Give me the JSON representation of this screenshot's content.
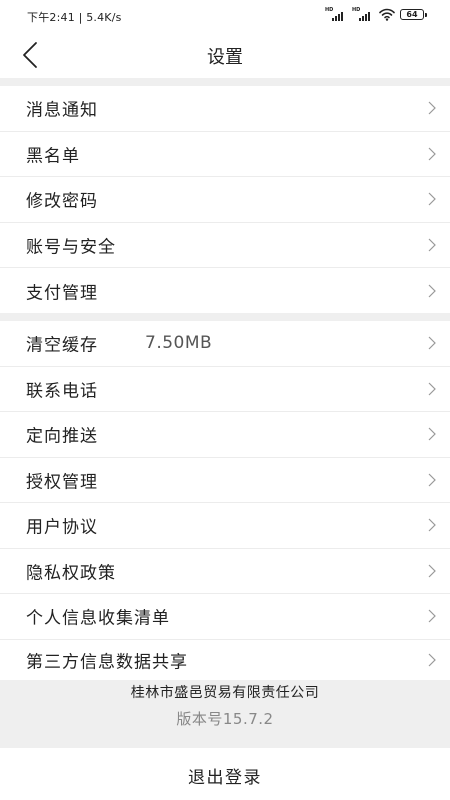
{
  "status_bar": {
    "time_speed": "下午2:41 | 5.4K/s",
    "signal_label": "HD",
    "battery": "64"
  },
  "nav": {
    "title": "设置"
  },
  "group1": [
    {
      "label": "消息通知"
    },
    {
      "label": "黑名单"
    },
    {
      "label": "修改密码"
    },
    {
      "label": "账号与安全"
    },
    {
      "label": "支付管理"
    }
  ],
  "group2": [
    {
      "label": "清空缓存",
      "value": "7.50MB"
    },
    {
      "label": "联系电话"
    },
    {
      "label": "定向推送"
    },
    {
      "label": "授权管理"
    },
    {
      "label": "用户协议"
    },
    {
      "label": "隐私权政策"
    },
    {
      "label": "个人信息收集清单"
    },
    {
      "label": "第三方信息数据共享"
    }
  ],
  "footer": {
    "company": "桂林市盛邑贸易有限责任公司",
    "version": "版本号15.7.2"
  },
  "logout": {
    "label": "退出登录"
  }
}
